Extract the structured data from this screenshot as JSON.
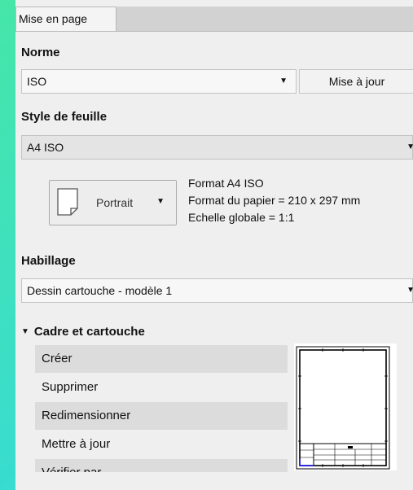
{
  "tab": {
    "label": "Mise en page"
  },
  "norme": {
    "label": "Norme",
    "value": "ISO",
    "update_button": "Mise à jour"
  },
  "style_feuille": {
    "label": "Style de feuille",
    "value": "A4 ISO"
  },
  "orientation": {
    "label": "Portrait",
    "icon": "page-icon"
  },
  "info": {
    "format": "Format A4 ISO",
    "papier": "Format du papier = 210 x 297 mm",
    "echelle": "Echelle globale = 1:1"
  },
  "habillage": {
    "label": "Habillage",
    "value": "Dessin cartouche - modèle 1"
  },
  "cadre": {
    "label": "Cadre et cartouche",
    "items": [
      "Créer",
      "Supprimer",
      "Redimensionner",
      "Mettre à jour",
      "Vérifier par"
    ]
  }
}
